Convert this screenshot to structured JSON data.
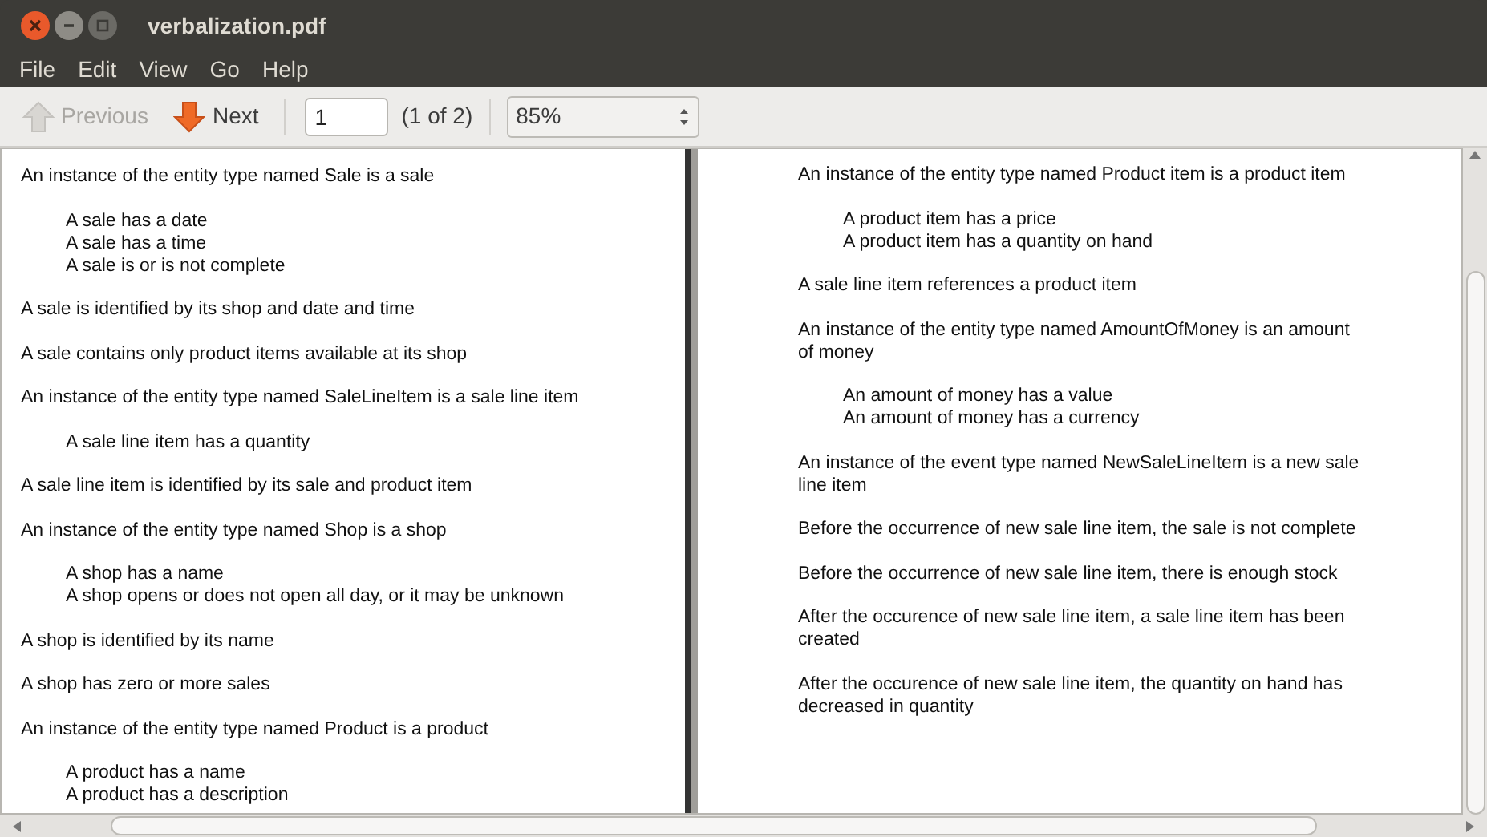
{
  "window": {
    "title": "verbalization.pdf"
  },
  "menu": [
    "File",
    "Edit",
    "View",
    "Go",
    "Help"
  ],
  "toolbar": {
    "previous": {
      "label": "Previous",
      "disabled": true
    },
    "next": {
      "label": "Next",
      "disabled": false
    },
    "page_field": {
      "value": "1"
    },
    "page_count": "(1 of 2)",
    "zoom": {
      "value": "85%"
    }
  },
  "pages": [
    {
      "blocks": [
        {
          "kind": "para",
          "text": "An instance of the entity type named Sale is a sale"
        },
        {
          "kind": "indent",
          "lines": [
            "A sale has a date",
            "A sale has a time",
            "A sale is or is not complete"
          ]
        },
        {
          "kind": "para",
          "text": "A sale is identified by its shop and date and time"
        },
        {
          "kind": "para",
          "text": "A sale contains only product items available at its shop"
        },
        {
          "kind": "para",
          "text": "An instance of the entity type named SaleLineItem is a sale line item"
        },
        {
          "kind": "indent",
          "lines": [
            "A sale line item has a quantity"
          ]
        },
        {
          "kind": "para",
          "text": "A sale line item is identified by its sale and product item"
        },
        {
          "kind": "para",
          "text": "An instance of the entity type named Shop is a shop"
        },
        {
          "kind": "indent",
          "lines": [
            "A shop has a name",
            "A shop opens or does not open all day, or it may be unknown"
          ]
        },
        {
          "kind": "para",
          "text": "A shop is identified by its name"
        },
        {
          "kind": "para",
          "text": "A shop has zero or more sales"
        },
        {
          "kind": "para",
          "text": "An instance of the entity type named Product is a product"
        },
        {
          "kind": "indent",
          "lines": [
            "A product has a name",
            "A product has a description"
          ]
        }
      ]
    },
    {
      "blocks": [
        {
          "kind": "para",
          "text": "An instance of the entity type named Product item is a product item"
        },
        {
          "kind": "indent",
          "lines": [
            "A product item has a price",
            "A product item has a quantity on hand"
          ]
        },
        {
          "kind": "para",
          "text": "A sale line item references a product item"
        },
        {
          "kind": "para",
          "text": "An instance of the entity type named AmountOfMoney is an amount of money"
        },
        {
          "kind": "indent",
          "lines": [
            "An amount of money has a value",
            "An amount of money has a currency"
          ]
        },
        {
          "kind": "para",
          "text": "An instance of the event type named NewSaleLineItem is a new sale line item"
        },
        {
          "kind": "para",
          "text": "Before the occurrence of new sale line item, the sale is not complete"
        },
        {
          "kind": "para",
          "text": "Before the occurrence of new sale line item, there is enough stock"
        },
        {
          "kind": "para",
          "text": "After the occurence of new sale line item, a sale line item has been created"
        },
        {
          "kind": "para",
          "text": "After the occurence of new sale line item, the quantity on hand has decreased in quantity"
        }
      ]
    }
  ]
}
